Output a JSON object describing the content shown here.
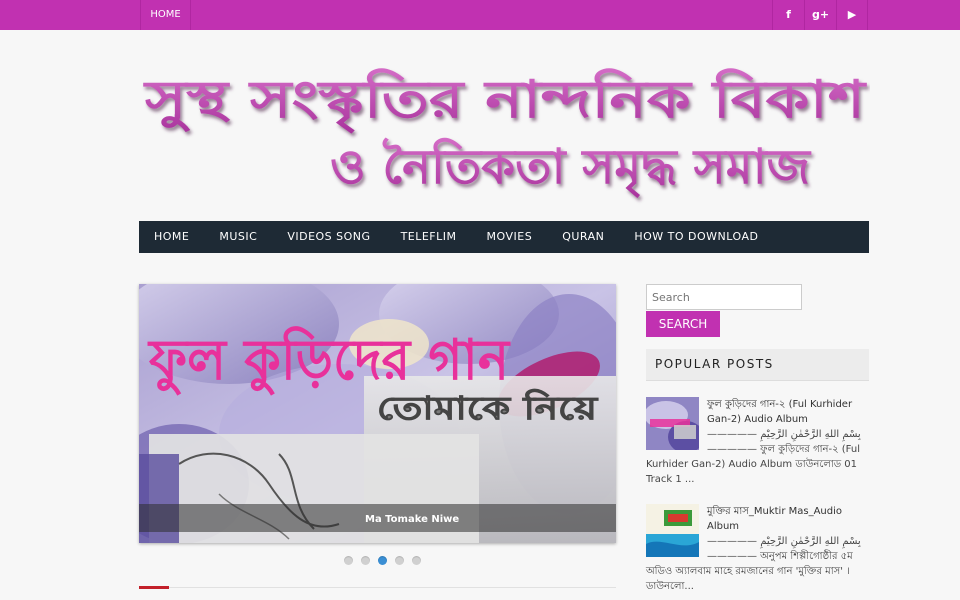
{
  "topbar": {
    "home_label": "HOME",
    "social": [
      {
        "icon": "facebook-icon",
        "glyph": "f"
      },
      {
        "icon": "google-plus-icon",
        "glyph": "g+"
      },
      {
        "icon": "youtube-icon",
        "glyph": "▶"
      }
    ]
  },
  "banner": {
    "line1": "সুস্থ সংস্কৃতির নান্দনিক বিকাশ",
    "line2": "ও নৈতিকতা সমৃদ্ধ সমাজ",
    "color": "#c54fb2"
  },
  "nav": {
    "items": [
      "HOME",
      "MUSIC",
      "VIDEOS SONG",
      "TELEFLIM",
      "MOVIES",
      "QURAN",
      "HOW TO DOWNLOAD"
    ]
  },
  "slider": {
    "title_text": "ফুল কুড়িদের গান",
    "subtitle_text": "তোমাকে নিয়ে",
    "caption": "Ma Tomake Niwe",
    "dots": 5,
    "active_dot": 3
  },
  "sidebar": {
    "search_placeholder": "Search",
    "search_button": "SEARCH",
    "popular_title": "POPULAR POSTS",
    "posts": [
      {
        "title": "ফুল কুড়িদের গান-২ (Ful Kurhider Gan-2) Audio Album",
        "body": "————— بِسْمِ اللهِ الرَّحْمٰنِ الرَّحِيْمِ ————— ফুল কুড়িদের গান-২ (Ful Kurhider Gan-2) Audio Album ডাউনলোড 01 Track 1 ..."
      },
      {
        "title": "মুক্তির মাস_Muktir Mas_Audio Album",
        "body": "————— بِسْمِ اللهِ الرَّحْمٰنِ الرَّحِيْمِ ————— অনুপম শিল্পীগোষ্ঠীর ৫ম অডিও অ্যালবাম মাহে রমজানের গান 'মুক্তির মাস' । ডাউনলো..."
      }
    ]
  }
}
